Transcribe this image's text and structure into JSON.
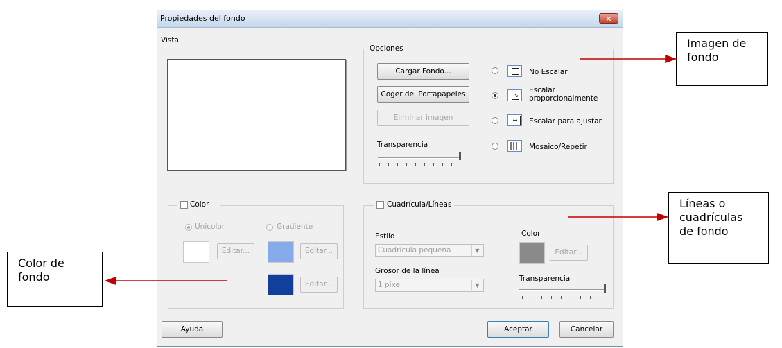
{
  "dialog": {
    "title": "Propiedades del fondo",
    "close_symbol": "✕"
  },
  "preview": {
    "label": "Vista"
  },
  "options": {
    "legend": "Opciones",
    "load_label": "Cargar Fondo...",
    "clipboard_label": "Coger del Portapapeles",
    "remove_label": "Eliminar imagen",
    "transparency_label": "Transparencia",
    "transparency_value": 1.0,
    "scale_options": [
      {
        "label": "No Escalar",
        "selected": false,
        "icon": "no-scale-icon"
      },
      {
        "label_line1": "Escalar",
        "label_line2": "proporcionalmente",
        "selected": true,
        "icon": "scale-proportional-icon"
      },
      {
        "label": "Escalar para ajustar",
        "selected": false,
        "icon": "stretch-fit-icon"
      },
      {
        "label": "Mosaico/Repetir",
        "selected": false,
        "icon": "tile-icon"
      }
    ]
  },
  "color_group": {
    "legend": "Color",
    "checked": false,
    "solid_label": "Unicolor",
    "gradient_label": "Gradiente",
    "solid_selected": true,
    "edit_label": "Editar...",
    "solid_color": "#ffffff",
    "gradient_color_1": "#86aaea",
    "gradient_color_2": "#123e9c"
  },
  "grid_group": {
    "legend": "Cuadrícula/Líneas",
    "checked": false,
    "style_label": "Estilo",
    "style_value": "Cuadrícula pequeña",
    "thickness_label": "Grosor de la línea",
    "thickness_value": "1 píxel",
    "color_label": "Color",
    "color_value": "#8a8a8a",
    "edit_label": "Editar...",
    "transparency_label": "Transparencia",
    "transparency_value": 1.0
  },
  "footer": {
    "help_label": "Ayuda",
    "ok_label": "Aceptar",
    "cancel_label": "Cancelar"
  },
  "callouts": {
    "image": "Imagen de fondo",
    "grid": "Líneas o cuadrículas de fondo",
    "color": "Color de fondo"
  },
  "colors": {
    "arrow": "#c00000"
  }
}
